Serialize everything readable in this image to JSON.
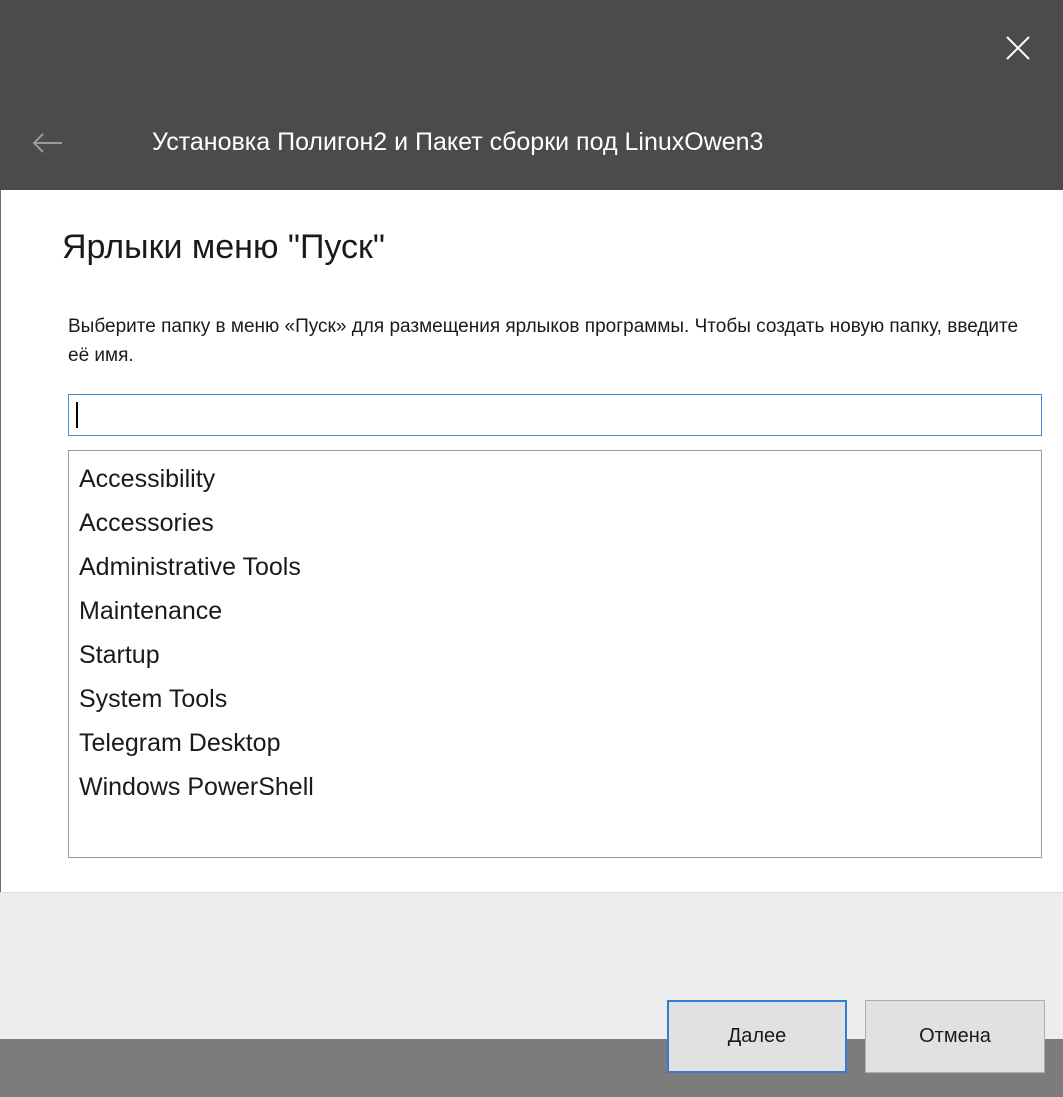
{
  "window": {
    "title": "Установка Полигон2 и Пакет сборки под LinuxOwen3",
    "close_icon": "close-icon",
    "back_icon": "back-arrow-icon"
  },
  "page": {
    "title": "Ярлыки меню \"Пуск\"",
    "instructions": "Выберите папку в меню «Пуск» для размещения ярлыков программы. Чтобы создать новую папку, введите её имя."
  },
  "folder_input": {
    "value": ""
  },
  "folders": [
    "Accessibility",
    "Accessories",
    "Administrative Tools",
    "Maintenance",
    "Startup",
    "System Tools",
    "Telegram Desktop",
    "Windows PowerShell"
  ],
  "buttons": {
    "next_underlined": "Д",
    "next_rest": "алее",
    "cancel": "Отмена"
  },
  "colors": {
    "titlebar": "#4b4b4b",
    "focus_accent": "#2f7fd1",
    "footer": "#ededed"
  }
}
